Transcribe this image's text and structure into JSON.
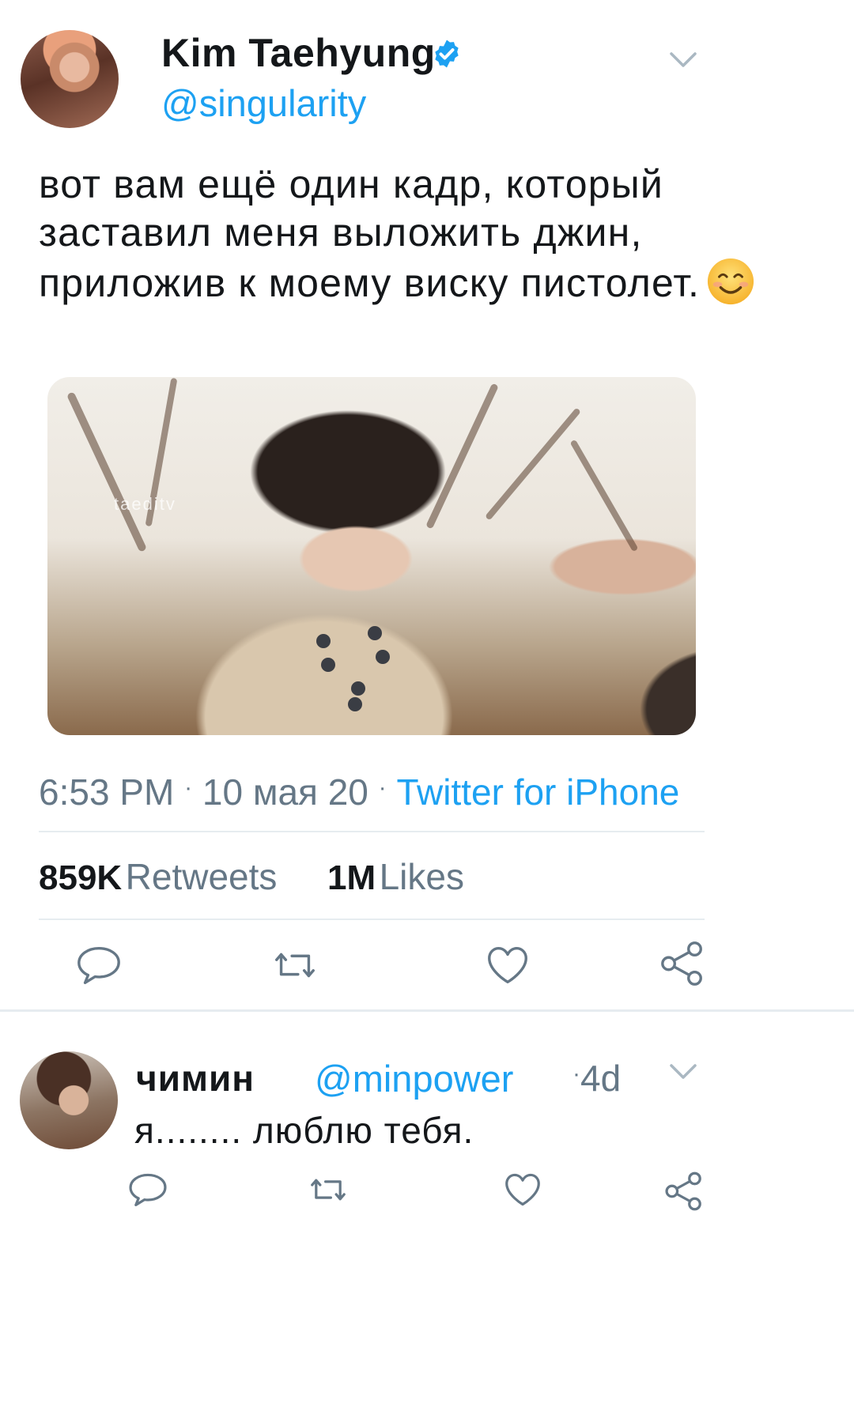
{
  "tweet": {
    "author": {
      "display_name": "Kim Taehyung",
      "handle": "@singularity",
      "verified": true
    },
    "text": "вот вам ещё один кадр, который заставил меня выложить джин, приложив к моему виску пистолет.",
    "emoji": "smiling-face-icon",
    "media": {
      "watermark": "taeditv"
    },
    "time": "6:53 PM",
    "date": "10 мая 20",
    "source": "Twitter for iPhone",
    "retweets_count": "859K",
    "retweets_label": "Retweets",
    "likes_count": "1M",
    "likes_label": "Likes"
  },
  "reply": {
    "display_name": "чимин",
    "handle": "@minpower",
    "time": "4d",
    "text": "я........ люблю тебя."
  },
  "colors": {
    "accent": "#1da1f2",
    "secondary_text": "#657786",
    "primary_text": "#14171a",
    "separator": "#e6ecf0"
  }
}
